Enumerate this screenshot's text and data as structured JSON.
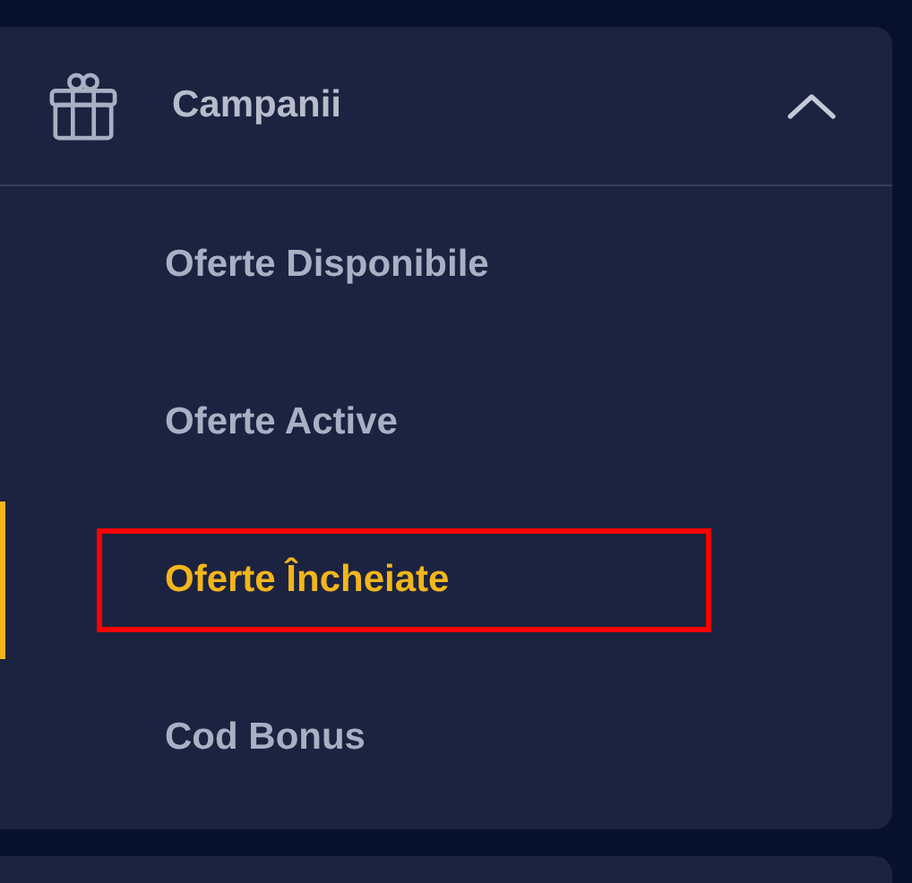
{
  "menu": {
    "title": "Campanii",
    "expanded": true,
    "items": [
      {
        "label": "Oferte Disponibile",
        "selected": false,
        "highlighted": false
      },
      {
        "label": "Oferte Active",
        "selected": false,
        "highlighted": false
      },
      {
        "label": "Oferte Încheiate",
        "selected": true,
        "highlighted": true
      },
      {
        "label": "Cod Bonus",
        "selected": false,
        "highlighted": false
      }
    ]
  }
}
